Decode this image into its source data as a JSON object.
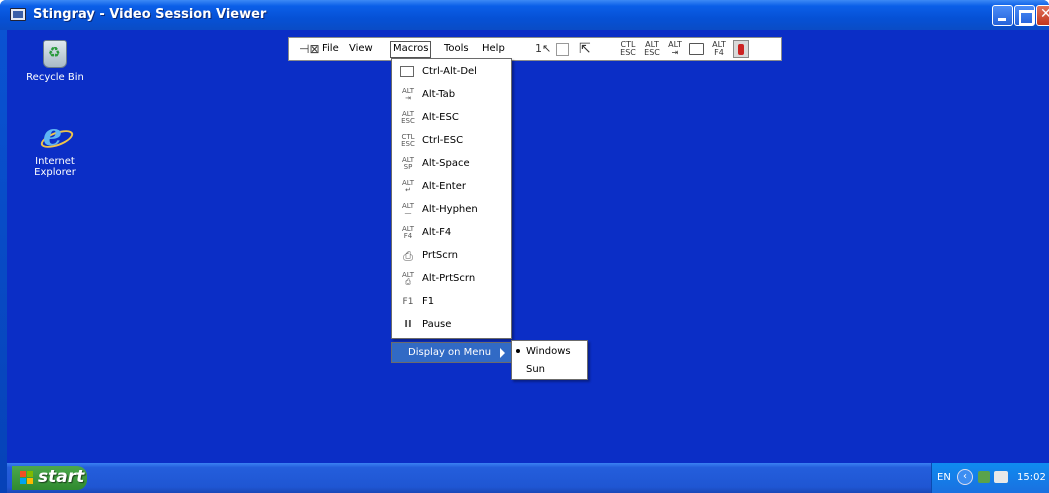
{
  "window": {
    "title": "Stingray - Video Session Viewer"
  },
  "desktop": {
    "icons": [
      {
        "label": "Recycle Bin",
        "icon": "recycle-bin-icon"
      },
      {
        "label": "Internet Explorer",
        "icon": "internet-explorer-icon"
      }
    ]
  },
  "toolbar": {
    "menus": [
      "File",
      "View",
      "Macros",
      "Tools",
      "Help"
    ],
    "active_menu": "Macros",
    "icons": {
      "single_cursor": "1",
      "ctl_esc": "CTL ESC",
      "alt_esc": "ALT ESC",
      "alt_tab": "ALT ⇥",
      "alt_f4": "ALT F4"
    }
  },
  "macros_menu": {
    "items": [
      {
        "label": "Ctrl-Alt-Del",
        "glyph": ""
      },
      {
        "label": "Alt-Tab",
        "glyph": "ALT ⇥"
      },
      {
        "label": "Alt-ESC",
        "glyph": "ALT ESC"
      },
      {
        "label": "Ctrl-ESC",
        "glyph": "CTL ESC"
      },
      {
        "label": "Alt-Space",
        "glyph": "ALT SP"
      },
      {
        "label": "Alt-Enter",
        "glyph": "ALT ↵"
      },
      {
        "label": "Alt-Hyphen",
        "glyph": "ALT —"
      },
      {
        "label": "Alt-F4",
        "glyph": "ALT F4"
      },
      {
        "label": "PrtScrn",
        "glyph": "⎙"
      },
      {
        "label": "Alt-PrtScrn",
        "glyph": "ALT ⎙"
      },
      {
        "label": "F1",
        "glyph": "F1"
      },
      {
        "label": "Pause",
        "glyph": "II"
      }
    ],
    "display_on_menu": "Display on Menu"
  },
  "submenu": {
    "items": [
      {
        "label": "Windows",
        "selected": true
      },
      {
        "label": "Sun",
        "selected": false
      }
    ]
  },
  "taskbar": {
    "start_label": "start",
    "language": "EN",
    "clock": "15:02"
  },
  "colors": {
    "desktop": "#0b2ec6",
    "titlebar": "#0651d6",
    "menu_highlight": "#316ac5",
    "start_button": "#3c9a3c"
  }
}
